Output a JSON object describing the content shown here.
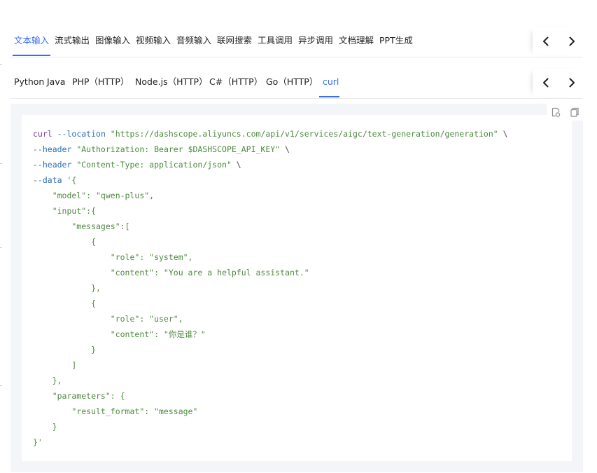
{
  "top_tabs": [
    {
      "label": "文本输入",
      "active": true
    },
    {
      "label": "流式输出",
      "active": false
    },
    {
      "label": "图像输入",
      "active": false
    },
    {
      "label": "视频输入",
      "active": false
    },
    {
      "label": "音频输入",
      "active": false
    },
    {
      "label": "联网搜索",
      "active": false
    },
    {
      "label": "工具调用",
      "active": false
    },
    {
      "label": "异步调用",
      "active": false
    },
    {
      "label": "文档理解",
      "active": false
    },
    {
      "label": "PPT生成",
      "active": false
    }
  ],
  "lang_tabs": [
    {
      "label": "Python",
      "active": false
    },
    {
      "label": "Java",
      "active": false
    },
    {
      "label": "PHP（HTTP）",
      "active": false
    },
    {
      "label": "Node.js（HTTP）",
      "active": false
    },
    {
      "label": "C#（HTTP）",
      "active": false
    },
    {
      "label": "Go（HTTP）",
      "active": false
    },
    {
      "label": "curl",
      "active": true
    }
  ],
  "icons": {
    "prev": "chevron-left-icon",
    "next": "chevron-right-icon",
    "expand": "code-view-icon",
    "copy": "copy-icon"
  },
  "colors": {
    "accent": "#3a6cf3",
    "panel_bg": "#f4f5f8",
    "cmd": "#7a3e9d",
    "flag": "#2f6fb3",
    "string": "#4d8a3f"
  },
  "code": {
    "line1": {
      "cmd": "curl",
      "flag": " --location",
      "str": " \"https://dashscope.aliyuncs.com/api/v1/services/aigc/text-generation/generation\"",
      "tail": " \\"
    },
    "line2": {
      "flag": "--header",
      "str": " \"Authorization: Bearer $DASHSCOPE_API_KEY\"",
      "tail": " \\"
    },
    "line3": {
      "flag": "--header",
      "str": " \"Content-Type: application/json\"",
      "tail": " \\"
    },
    "line4": {
      "flag": "--data",
      "str": " '{"
    },
    "line5": "    \"model\": \"qwen-plus\",",
    "line6": "    \"input\":{",
    "line7": "        \"messages\":[",
    "line8": "            {",
    "line9": "                \"role\": \"system\",",
    "line10": "                \"content\": \"You are a helpful assistant.\"",
    "line11": "            },",
    "line12": "            {",
    "line13": "                \"role\": \"user\",",
    "line14": "                \"content\": \"你是谁？\"",
    "line15": "            }",
    "line16": "        ]",
    "line17": "    },",
    "line18": "    \"parameters\": {",
    "line19": "        \"result_format\": \"message\"",
    "line20": "    }",
    "line21": "}'"
  }
}
